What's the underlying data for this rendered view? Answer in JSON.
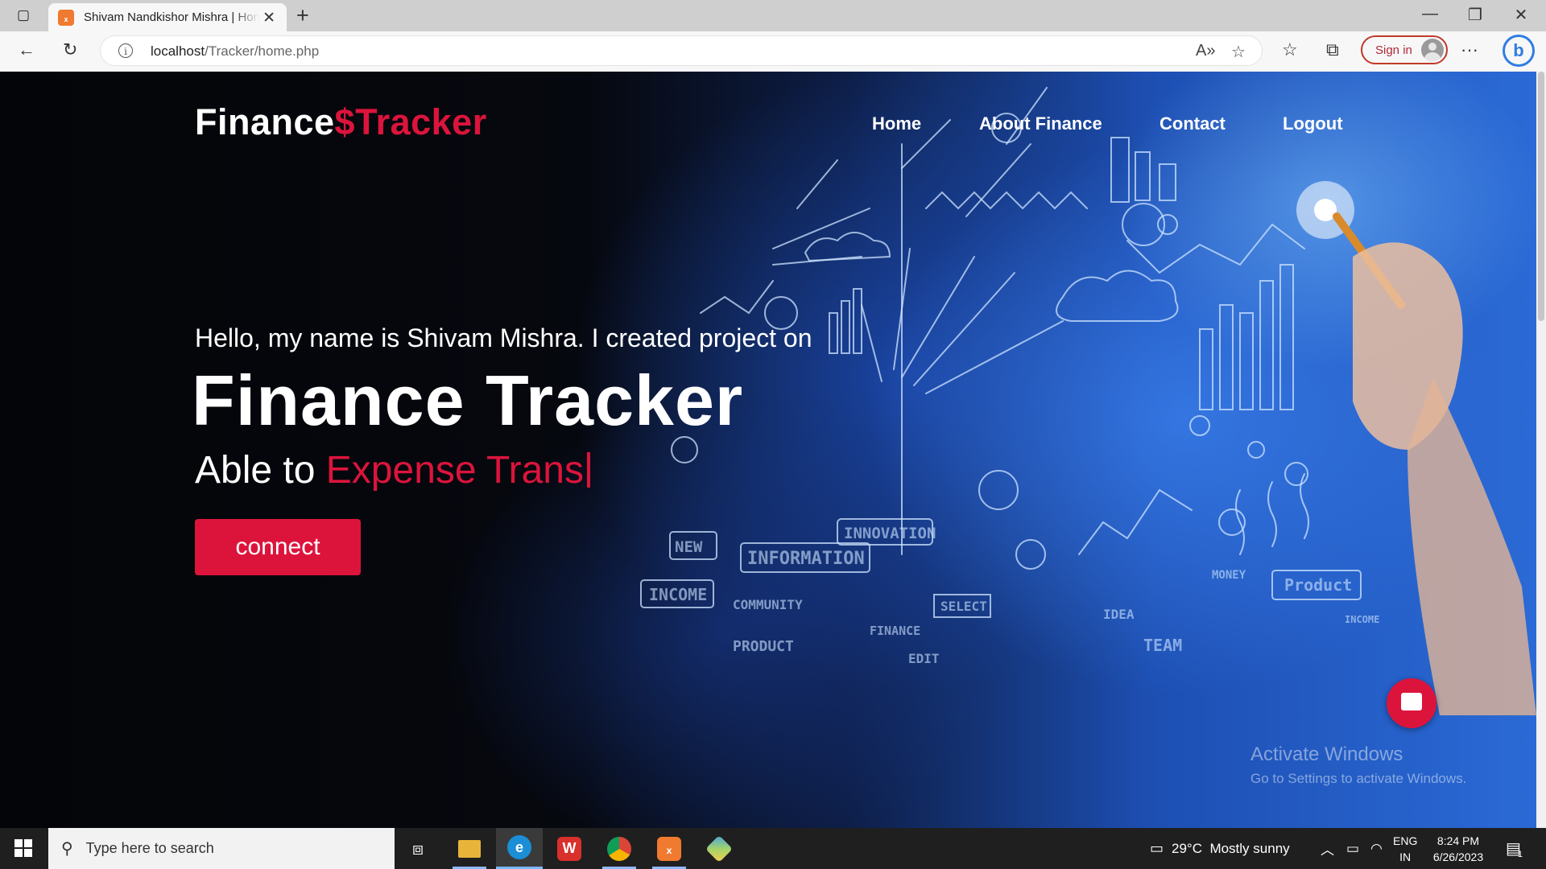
{
  "browser": {
    "tab_title": "Shivam Nandkishor Mishra | Home",
    "favicon": "xampp-icon",
    "url_host": "localhost",
    "url_path": "/Tracker/home.php",
    "signin_label": "Sign in"
  },
  "site": {
    "brand_prefix": "Finance",
    "brand_symbol": "$",
    "brand_suffix": "Tracker",
    "nav": [
      "Home",
      "About Finance",
      "Contact",
      "Logout"
    ],
    "hero": {
      "intro": "Hello, my name is Shivam Mishra. I created project on",
      "title": "Finance Tracker",
      "able_prefix": "Able to",
      "typed_text": "Expense Trans",
      "button_label": "connect"
    },
    "accent_color": "#dc143c"
  },
  "watermark": {
    "title": "Activate Windows",
    "subtitle": "Go to Settings to activate Windows."
  },
  "taskbar": {
    "search_placeholder": "Type here to search",
    "weather": "29°C  Mostly sunny",
    "lang_top": "ENG",
    "lang_bottom": "IN",
    "time": "8:24 PM",
    "date": "6/26/2023",
    "notification_count": "1"
  },
  "art_labels": [
    "INNOVATION",
    "INFORMATION",
    "NEW",
    "INCOME",
    "COMMUNITY",
    "PRODUCT",
    "FINANCE",
    "SELECT",
    "EDIT",
    "IDEA",
    "TEAM",
    "MONEY",
    "Product",
    "INCOME"
  ]
}
